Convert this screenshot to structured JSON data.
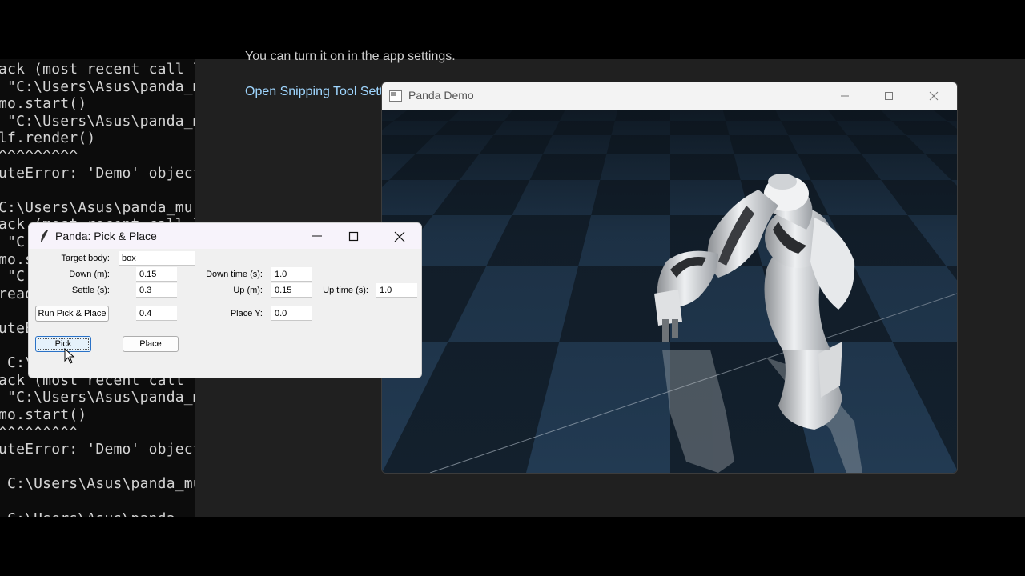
{
  "terminal": {
    "lines": [
      "ack (most recent call l",
      " \"C:\\Users\\Asus\\panda_m",
      "mo.start()",
      " \"C:\\Users\\Asus\\panda_m",
      "lf.render()",
      "^^^^^^^^^",
      "uteError: 'Demo' object",
      "",
      "C:\\Users\\Asus\\panda_mu",
      "ack (most recent call l",
      " \"C:\\Users\\Asus\\panda_m",
      "mo.start()",
      " \"C:\\Users\\Asus\\panda_m",
      "read",
      "",
      "uteError: 'Demo' object",
      "",
      " C:\\Users\\Asus\\panda_mu",
      "ack (most recent call l",
      " \"C:\\Users\\Asus\\panda_m",
      "mo.start()",
      "^^^^^^^^^",
      "uteError: 'Demo' object",
      "",
      " C:\\Users\\Asus\\panda_mu",
      "",
      " C:\\Users\\Asus\\panda_"
    ]
  },
  "settings": {
    "note": "You can turn it on in the app settings.",
    "link": "Open Snipping Tool Settings"
  },
  "demo_window": {
    "title": "Panda Demo"
  },
  "dialog": {
    "title": "Panda: Pick & Place",
    "target_body": {
      "label": "Target body:",
      "value": "box"
    },
    "down": {
      "label": "Down (m):",
      "value": "0.15"
    },
    "down_time": {
      "label": "Down time (s):",
      "value": "1.0"
    },
    "settle": {
      "label": "Settle (s):",
      "value": "0.3"
    },
    "up": {
      "label": "Up (m):",
      "value": "0.15"
    },
    "up_time": {
      "label": "Up time (s):",
      "value": "1.0"
    },
    "run_button": "Run Pick & Place",
    "run_value": "0.4",
    "place_y": {
      "label": "Place Y:",
      "value": "0.0"
    },
    "pick_button": "Pick",
    "place_button": "Place"
  },
  "colors": {
    "settings_bg": "#202020",
    "link": "#9fd6ff",
    "floor_dark": "#13202d",
    "floor_light": "#355574"
  }
}
